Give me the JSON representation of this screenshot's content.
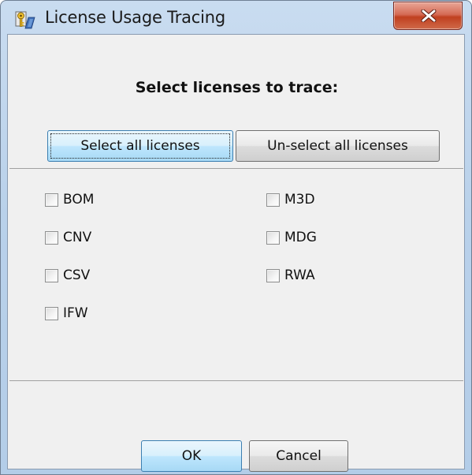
{
  "window": {
    "title": "License Usage Tracing"
  },
  "dialog": {
    "heading": "Select licenses to trace:",
    "select_all_label": "Select all licenses",
    "unselect_all_label": "Un-select all licenses"
  },
  "licenses": [
    {
      "label": "BOM",
      "checked": false
    },
    {
      "label": "CNV",
      "checked": false
    },
    {
      "label": "CSV",
      "checked": false
    },
    {
      "label": "IFW",
      "checked": false
    },
    {
      "label": "M3D",
      "checked": false
    },
    {
      "label": "MDG",
      "checked": false
    },
    {
      "label": "RWA",
      "checked": false
    }
  ],
  "footer": {
    "ok_label": "OK",
    "cancel_label": "Cancel"
  },
  "icons": {
    "app": "license-key-icon",
    "close": "close-icon"
  },
  "colors": {
    "titlebar": "#b9d1ea",
    "close_button": "#c0401f",
    "dialog_background": "#f0f0f0",
    "focused_button": "#bee6fd"
  }
}
